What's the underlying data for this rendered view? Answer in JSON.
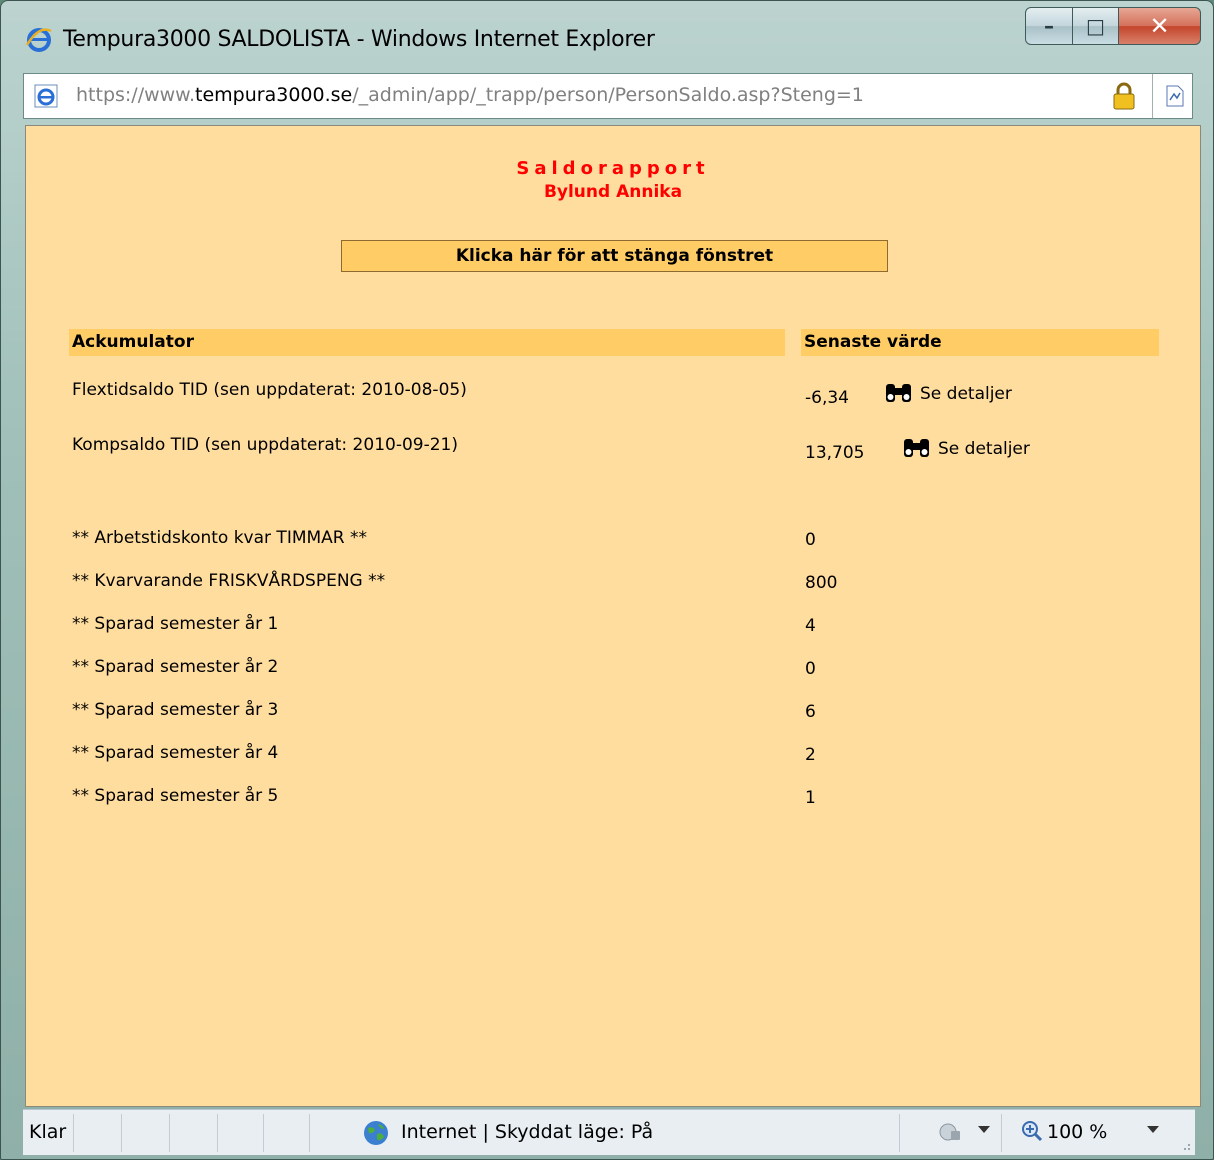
{
  "window": {
    "title": "Tempura3000 SALDOLISTA - Windows Internet Explorer",
    "url_scheme": "https://www.",
    "url_domain": "tempura3000.se",
    "url_path": "/_admin/app/_trapp/person/PersonSaldo.asp?Steng=1"
  },
  "report": {
    "title": "Saldorapport",
    "name": "Bylund Annika",
    "close_link": "Klicka här för att stänga fönstret"
  },
  "table": {
    "col_accumulator": "Ackumulator",
    "col_value": "Senaste värde",
    "detail_rows": [
      {
        "label": "Flextidsaldo TID (sen uppdaterat: 2010-08-05)",
        "value": "-6,34",
        "link": "Se detaljer"
      },
      {
        "label": "Kompsaldo TID (sen uppdaterat: 2010-09-21)",
        "value": "13,705",
        "link": "Se detaljer"
      }
    ],
    "rows": [
      {
        "label": "** Arbetstidskonto kvar TIMMAR **",
        "value": "0"
      },
      {
        "label": "** Kvarvarande FRISKVÅRDSPENG **",
        "value": "800"
      },
      {
        "label": "** Sparad semester år 1",
        "value": "4"
      },
      {
        "label": "** Sparad semester år 2",
        "value": "0"
      },
      {
        "label": "** Sparad semester år 3",
        "value": "6"
      },
      {
        "label": "** Sparad semester år 4",
        "value": "2"
      },
      {
        "label": "** Sparad semester år 5",
        "value": "1"
      }
    ]
  },
  "status": {
    "text": "Klar",
    "zone": "Internet | Skyddat läge: På",
    "zoom": "100 %"
  },
  "colors": {
    "page_bg": "#ffdd9f",
    "header_bg": "#ffcc66",
    "title_red": "#ff0000"
  }
}
